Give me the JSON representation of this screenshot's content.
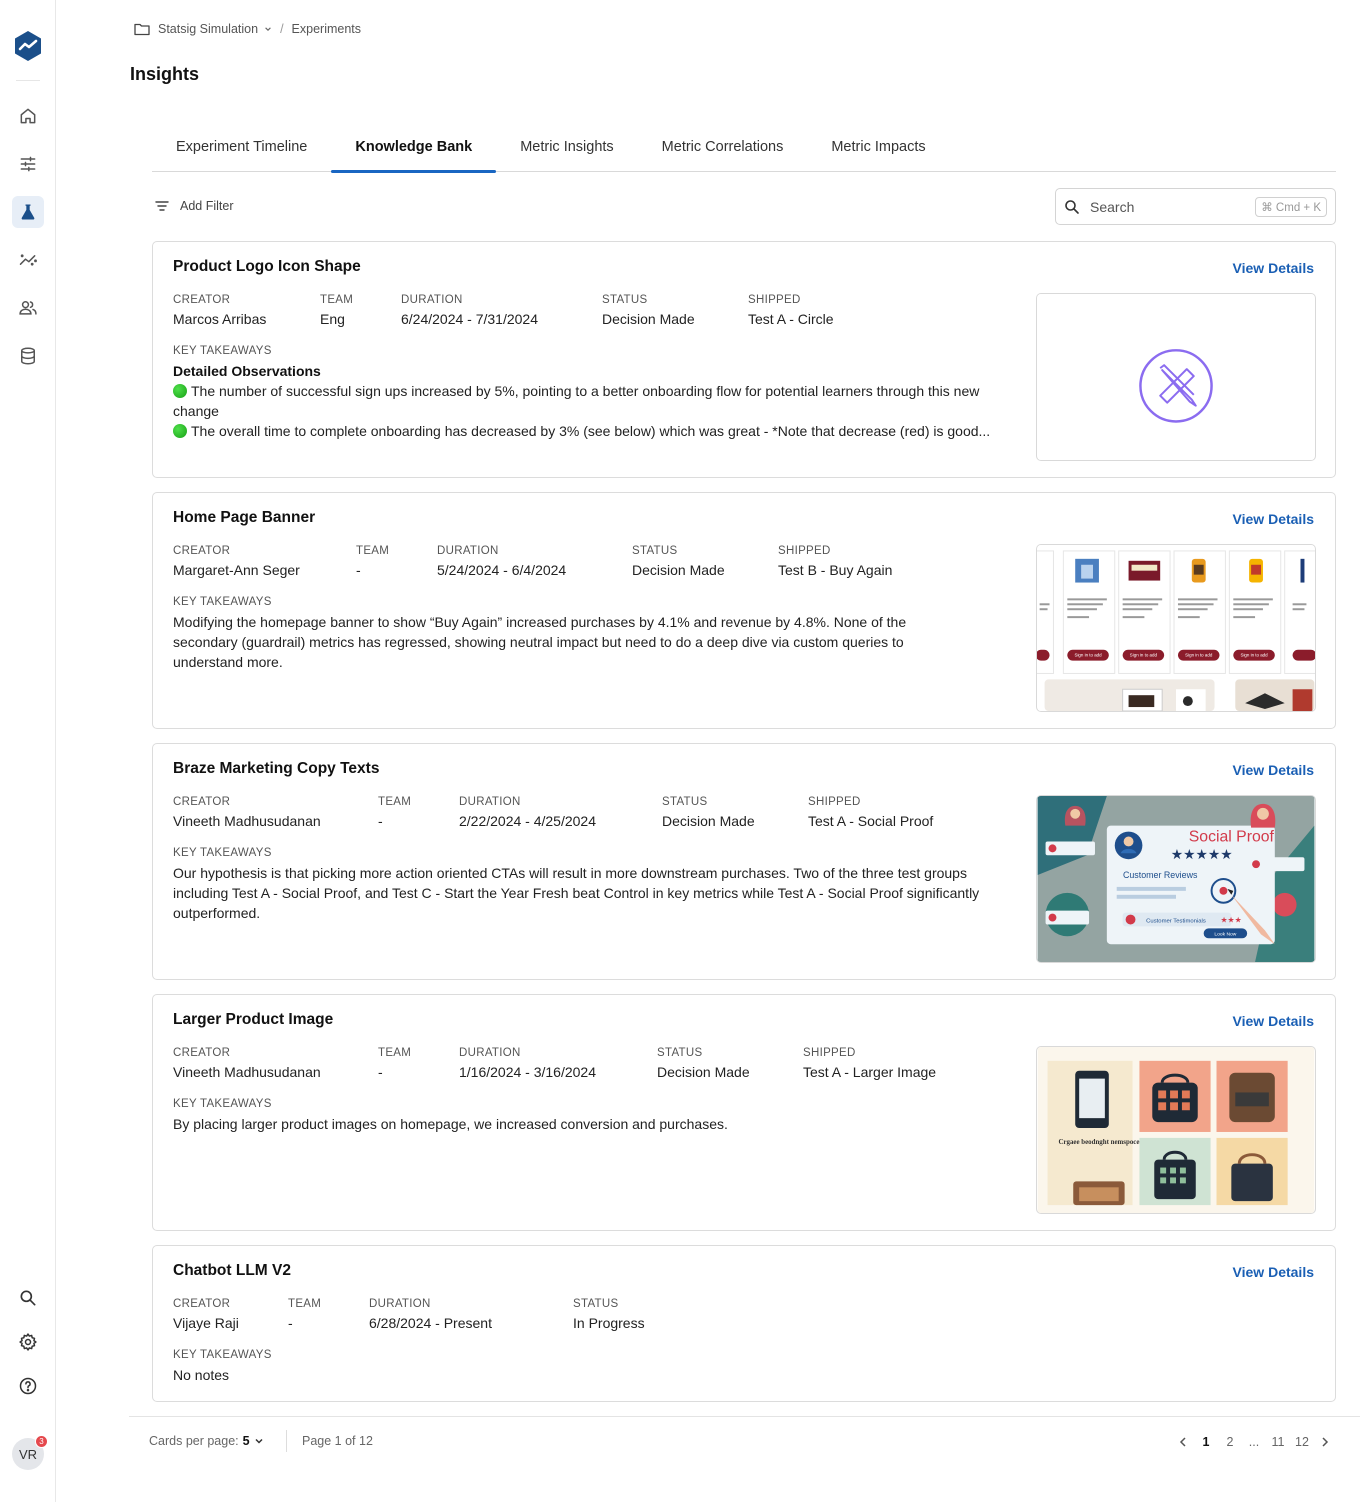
{
  "breadcrumb": {
    "project": "Statsig Simulation",
    "separator": "/",
    "section": "Experiments"
  },
  "page": {
    "title": "Insights"
  },
  "tabs": [
    {
      "label": "Experiment Timeline",
      "active": false
    },
    {
      "label": "Knowledge Bank",
      "active": true
    },
    {
      "label": "Metric Insights",
      "active": false
    },
    {
      "label": "Metric Correlations",
      "active": false
    },
    {
      "label": "Metric Impacts",
      "active": false
    }
  ],
  "filter": {
    "add_filter_label": "Add Filter"
  },
  "search": {
    "placeholder": "Search",
    "shortcut": "⌘ Cmd + K"
  },
  "labels": {
    "creator": "CREATOR",
    "team": "TEAM",
    "duration": "DURATION",
    "status": "STATUS",
    "shipped": "SHIPPED",
    "key_takeaways": "KEY TAKEAWAYS",
    "view_details": "View Details"
  },
  "cards": [
    {
      "title": "Product Logo Icon Shape",
      "creator": "Marcos Arribas",
      "team": "Eng",
      "duration": "6/24/2024 - 7/31/2024",
      "status": "Decision Made",
      "shipped": "Test A - Circle",
      "takeaway_heading": "Detailed Observations",
      "takeaway_points": [
        "The number of successful sign ups increased by 5%, pointing to a better onboarding flow for potential learners through this new change",
        "The overall time to complete onboarding has decreased by 3% (see below) which was great - *Note that decrease (red) is good..."
      ],
      "thumbnail": "pencil-ruler-circle-icon"
    },
    {
      "title": "Home Page Banner",
      "creator": "Margaret-Ann Seger",
      "team": "-",
      "duration": "5/24/2024 - 6/4/2024",
      "status": "Decision Made",
      "shipped": "Test B - Buy Again",
      "takeaway": "Modifying the homepage banner to show “Buy Again” increased purchases by 4.1% and revenue by 4.8%. None of the secondary (guardrail) metrics has regressed, showing neutral impact but need to do a deep dive via custom queries to understand more.",
      "thumbnail": "product-carousel-screenshot",
      "thumb_button": "Sign in to add"
    },
    {
      "title": "Braze Marketing Copy Texts",
      "creator": "Vineeth Madhusudanan",
      "team": "-",
      "duration": "2/22/2024 - 4/25/2024",
      "status": "Decision Made",
      "shipped": "Test A - Social Proof",
      "takeaway": "Our hypothesis is that picking more action oriented CTAs will result in more downstream purchases. Two of the three test groups including Test A - Social Proof, and Test C - Start the Year Fresh beat Control in key metrics while Test A - Social Proof significantly outperformed.",
      "thumbnail": "social-proof-illustration",
      "thumb_texts": {
        "headline": "Social Proof",
        "reviews": "Customer Reviews",
        "testimonials": "Customer Testimonials",
        "cta": "Look Now"
      }
    },
    {
      "title": "Larger Product Image",
      "creator": "Vineeth Madhusudanan",
      "team": "-",
      "duration": "1/16/2024 - 3/16/2024",
      "status": "Decision Made",
      "shipped": "Test A - Larger Image",
      "takeaway": "By placing larger product images on homepage, we increased conversion and purchases.",
      "thumbnail": "product-grid-illustration",
      "thumb_caption": "Crgaee beodnght nemspoce"
    },
    {
      "title": "Chatbot LLM V2",
      "creator": "Vijaye Raji",
      "team": "-",
      "duration": "6/28/2024 - Present",
      "status": "In Progress",
      "takeaway": "No notes"
    }
  ],
  "footer": {
    "cards_per_page_label": "Cards per page:",
    "cards_per_page_value": "5",
    "page_info": "Page 1 of 12",
    "pages": [
      "1",
      "2",
      "...",
      "11",
      "12"
    ],
    "current_page": "1"
  },
  "user": {
    "initials": "VR",
    "notifications": "3"
  },
  "colors": {
    "accent": "#1966c2",
    "link": "#1a5fb4",
    "brand": "#1b4f8a",
    "success_dot": "#22b020",
    "badge": "#e5484d"
  }
}
